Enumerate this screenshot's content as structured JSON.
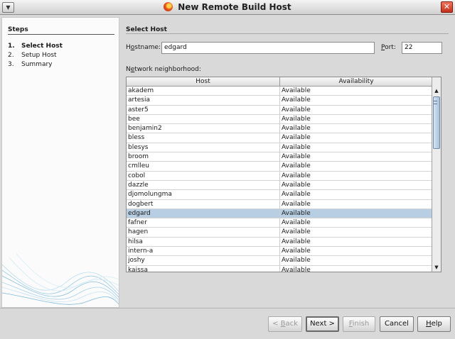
{
  "window": {
    "title": "New Remote Build Host",
    "menu_glyph": "▼",
    "close_glyph": "✕",
    "icon": "netbeans-icon"
  },
  "steps": {
    "heading": "Steps",
    "items": [
      {
        "num": "1.",
        "label": "Select Host",
        "active": true
      },
      {
        "num": "2.",
        "label": "Setup Host",
        "active": false
      },
      {
        "num": "3.",
        "label": "Summary",
        "active": false
      }
    ]
  },
  "main": {
    "heading": "Select Host",
    "hostname": {
      "label_pre": "H",
      "label_mn": "o",
      "label_post": "stname:",
      "value": "edgard"
    },
    "port": {
      "label_mn": "P",
      "label_post": "ort:",
      "value": "22"
    },
    "neighborhood": {
      "label_pre": "N",
      "label_mn": "e",
      "label_post": "twork neighborhood:"
    }
  },
  "table": {
    "columns": [
      "Host",
      "Availability"
    ],
    "rows": [
      {
        "host": "akadem",
        "availability": "Available"
      },
      {
        "host": "artesia",
        "availability": "Available"
      },
      {
        "host": "aster5",
        "availability": "Available"
      },
      {
        "host": "bee",
        "availability": "Available"
      },
      {
        "host": "benjamin2",
        "availability": "Available"
      },
      {
        "host": "bless",
        "availability": "Available"
      },
      {
        "host": "blesys",
        "availability": "Available"
      },
      {
        "host": "broom",
        "availability": "Available"
      },
      {
        "host": "cmlleu",
        "availability": "Available"
      },
      {
        "host": "cobol",
        "availability": "Available"
      },
      {
        "host": "dazzle",
        "availability": "Available"
      },
      {
        "host": "djomolungma",
        "availability": "Available"
      },
      {
        "host": "dogbert",
        "availability": "Available"
      },
      {
        "host": "edgard",
        "availability": "Available",
        "selected": true
      },
      {
        "host": "fafner",
        "availability": "Available"
      },
      {
        "host": "hagen",
        "availability": "Available"
      },
      {
        "host": "hilsa",
        "availability": "Available"
      },
      {
        "host": "intern-a",
        "availability": "Available"
      },
      {
        "host": "joshy",
        "availability": "Available"
      },
      {
        "host": "kaissa",
        "availability": "Available"
      }
    ],
    "scroll_up_glyph": "▲",
    "scroll_down_glyph": "▼"
  },
  "buttons": {
    "back": {
      "pre": "< ",
      "mn": "B",
      "post": "ack",
      "enabled": false
    },
    "next": {
      "label": "Next >",
      "enabled": true
    },
    "finish": {
      "mn": "F",
      "post": "inish",
      "enabled": false
    },
    "cancel": {
      "label": "Cancel",
      "enabled": true
    },
    "help": {
      "mn": "H",
      "post": "elp",
      "enabled": true
    }
  }
}
